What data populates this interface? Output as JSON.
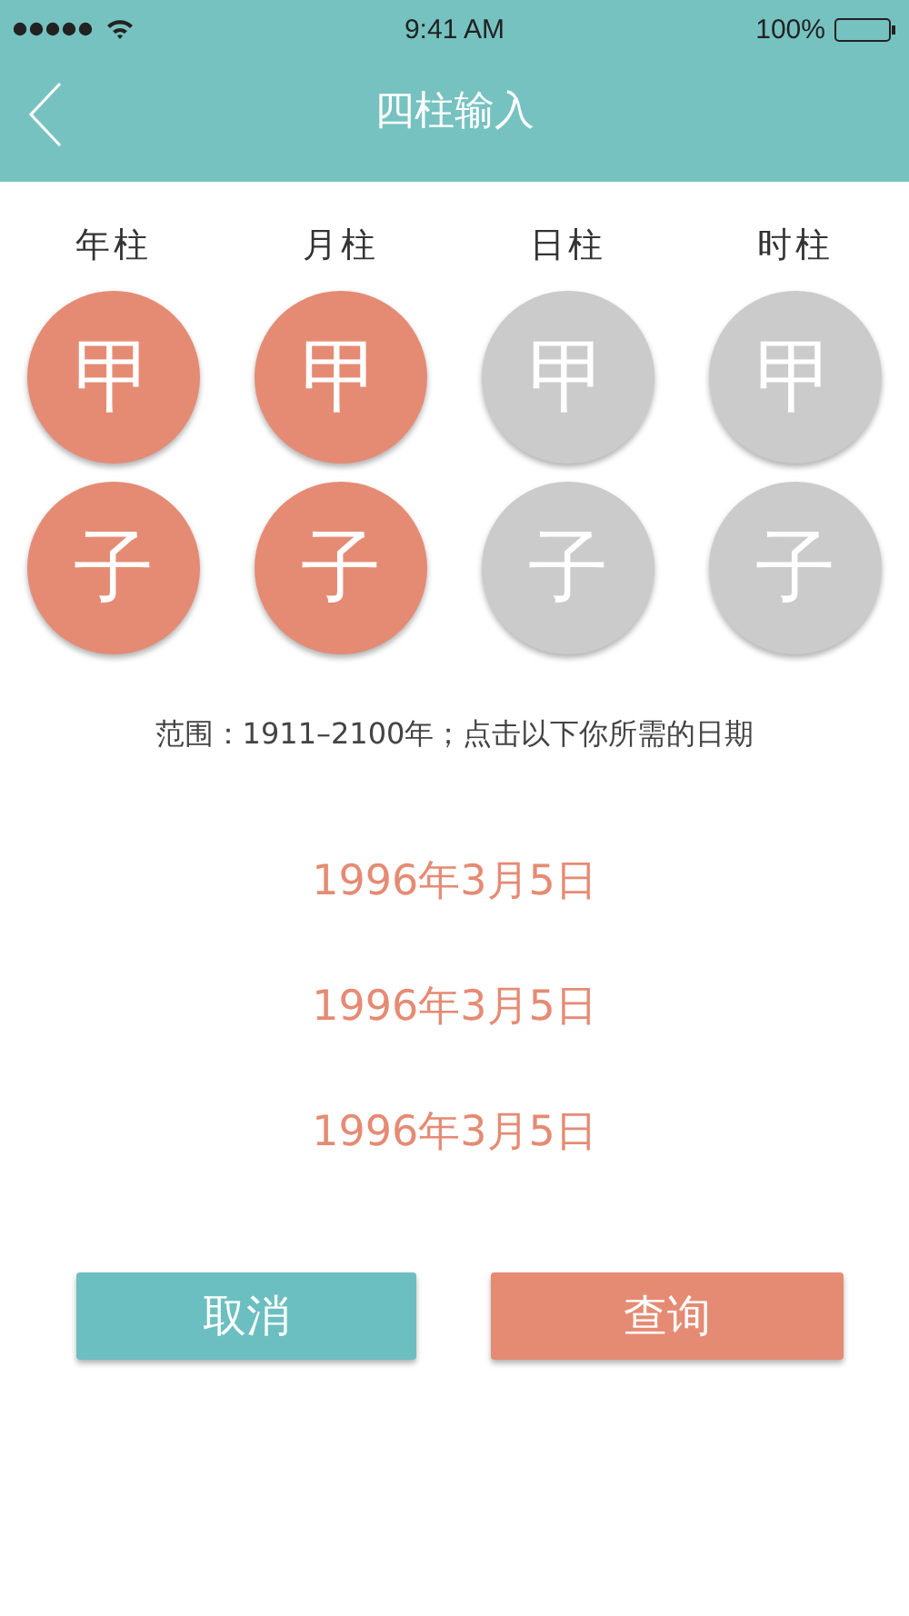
{
  "status_bar": {
    "time": "9:41 AM",
    "battery": "100%"
  },
  "nav": {
    "title": "四柱输入"
  },
  "pillars": [
    {
      "label": "年柱",
      "stem": "甲",
      "branch": "子",
      "set": true
    },
    {
      "label": "月柱",
      "stem": "甲",
      "branch": "子",
      "set": true
    },
    {
      "label": "日柱",
      "stem": "甲",
      "branch": "子",
      "set": false
    },
    {
      "label": "时柱",
      "stem": "甲",
      "branch": "子",
      "set": false
    }
  ],
  "range_hint": "范围：1911–2100年；点击以下你所需的日期",
  "dates": [
    "1996年3月5日",
    "1996年3月5日",
    "1996年3月5日"
  ],
  "buttons": [
    {
      "label": "取消",
      "kind": "cancel"
    },
    {
      "label": "查询",
      "kind": "query"
    }
  ]
}
